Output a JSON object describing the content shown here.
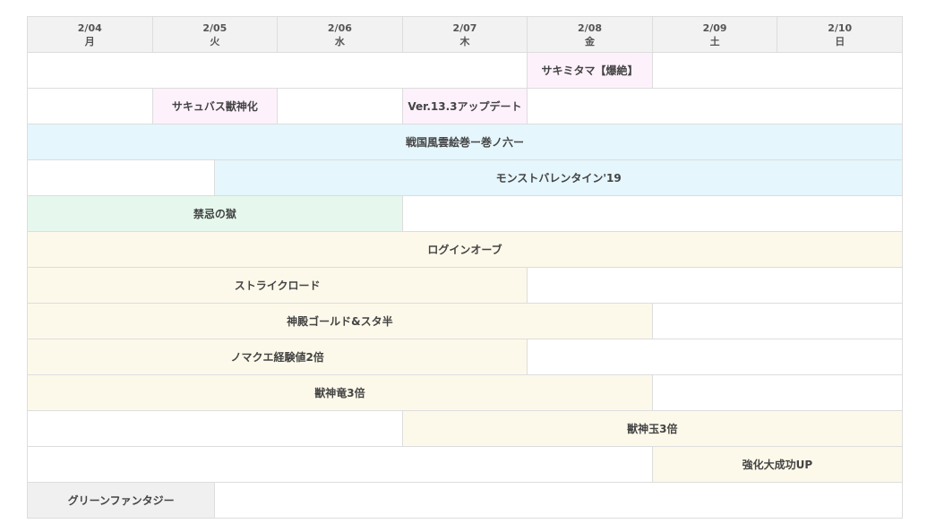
{
  "days": [
    {
      "date": "2/04",
      "weekday": "月"
    },
    {
      "date": "2/05",
      "weekday": "火"
    },
    {
      "date": "2/06",
      "weekday": "水"
    },
    {
      "date": "2/07",
      "weekday": "木"
    },
    {
      "date": "2/08",
      "weekday": "金"
    },
    {
      "date": "2/09",
      "weekday": "土"
    },
    {
      "date": "2/10",
      "weekday": "日"
    }
  ],
  "colors": {
    "pink": "#fdf1fb",
    "blue": "#e5f6fc",
    "green": "#e6f8ee",
    "yellow": "#fdf9ea",
    "gray": "#f0f0f0"
  },
  "rows": [
    {
      "cells": [
        {
          "span": 8
        },
        {
          "span": 2,
          "label": "サキミタマ【爆絶】",
          "color": "pink"
        },
        {
          "span": 4
        }
      ]
    },
    {
      "cells": [
        {
          "span": 2
        },
        {
          "span": 2,
          "label": "サキュバス獣神化",
          "color": "pink"
        },
        {
          "span": 2
        },
        {
          "span": 2,
          "label": "Ver.13.3アップデート",
          "color": "pink"
        },
        {
          "span": 6
        }
      ]
    },
    {
      "cells": [
        {
          "span": 14,
          "label": "戦国風雲絵巻ー巻ノ六ー",
          "color": "blue"
        }
      ]
    },
    {
      "cells": [
        {
          "span": 3
        },
        {
          "span": 11,
          "label": "モンストバレンタイン'19",
          "color": "blue"
        }
      ]
    },
    {
      "cells": [
        {
          "span": 6,
          "label": "禁忌の獄",
          "color": "green"
        },
        {
          "span": 8
        }
      ]
    },
    {
      "cells": [
        {
          "span": 14,
          "label": "ログインオーブ",
          "color": "yellow"
        }
      ]
    },
    {
      "cells": [
        {
          "span": 8,
          "label": "ストライクロード",
          "color": "yellow"
        },
        {
          "span": 6
        }
      ]
    },
    {
      "cells": [
        {
          "span": 10,
          "label": "神殿ゴールド&スタ半",
          "color": "yellow"
        },
        {
          "span": 4
        }
      ]
    },
    {
      "cells": [
        {
          "span": 8,
          "label": "ノマクエ経験値2倍",
          "color": "yellow"
        },
        {
          "span": 6
        }
      ]
    },
    {
      "cells": [
        {
          "span": 10,
          "label": "獣神竜3倍",
          "color": "yellow"
        },
        {
          "span": 4
        }
      ]
    },
    {
      "cells": [
        {
          "span": 6
        },
        {
          "span": 8,
          "label": "獣神玉3倍",
          "color": "yellow"
        }
      ]
    },
    {
      "cells": [
        {
          "span": 10
        },
        {
          "span": 4,
          "label": "強化大成功UP",
          "color": "yellow"
        }
      ]
    },
    {
      "cells": [
        {
          "span": 3,
          "label": "グリーンファンタジー",
          "color": "gray"
        },
        {
          "span": 11
        }
      ]
    }
  ]
}
